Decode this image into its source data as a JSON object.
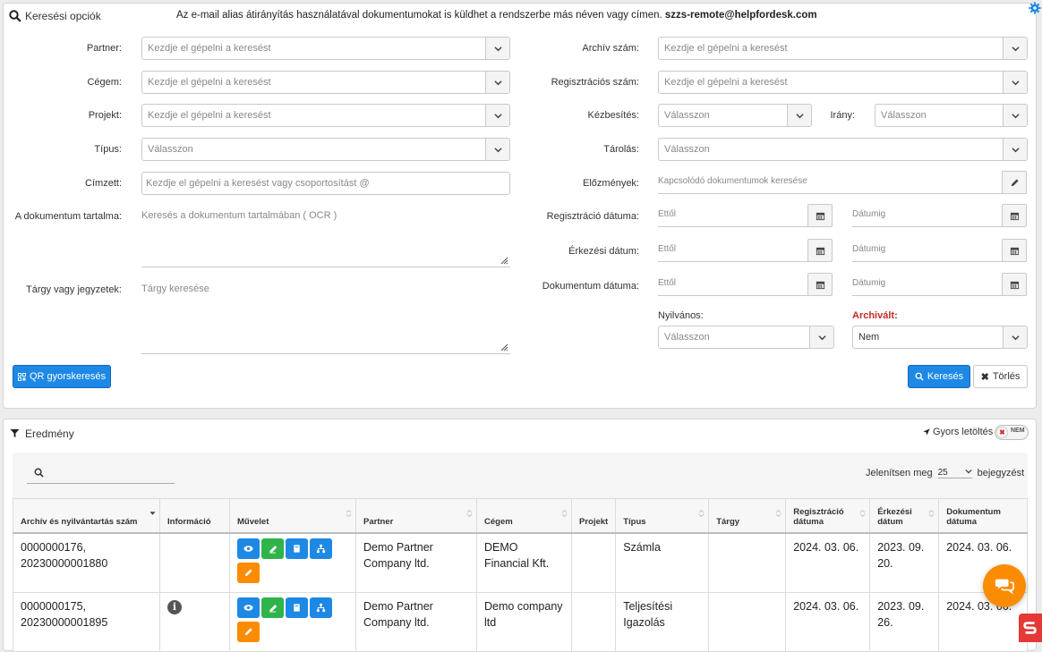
{
  "search": {
    "title": "Keresési opciók",
    "notice": "Az e-mail alias átirányítás használatával dokumentumokat is küldhet a rendszerbe más néven vagy címen.",
    "notice_email": "szzs-remote@helpfordesk.com",
    "left": {
      "partner": {
        "label": "Partner:",
        "placeholder": "Kezdje el gépelni a keresést"
      },
      "cegem": {
        "label": "Cégem:",
        "placeholder": "Kezdje el gépelni a keresést"
      },
      "projekt": {
        "label": "Projekt:",
        "placeholder": "Kezdje el gépelni a keresést"
      },
      "tipus": {
        "label": "Típus:",
        "placeholder": "Válasszon"
      },
      "cimzett": {
        "label": "Címzett:",
        "placeholder": "Kezdje el gépelni a keresést vagy csoportosítást @"
      },
      "tartalom": {
        "label": "A dokumentum tartalma:",
        "placeholder": "Keresés a dokumentum tartalmában ( OCR )"
      },
      "targy": {
        "label": "Tárgy vagy jegyzetek:",
        "placeholder": "Tárgy keresése"
      }
    },
    "right": {
      "archiv": {
        "label": "Archív szám:",
        "placeholder": "Kezdje el gépelni a keresést"
      },
      "regszam": {
        "label": "Regisztrációs szám:",
        "placeholder": "Kezdje el gépelni a keresést"
      },
      "kezbesites": {
        "label": "Kézbesítés:",
        "placeholder": "Válasszon"
      },
      "irany": {
        "label": "Irány:",
        "placeholder": "Válasszon"
      },
      "tarolas": {
        "label": "Tárolás:",
        "placeholder": "Válasszon"
      },
      "elozmenyek": {
        "label": "Előzmények:",
        "placeholder": "Kapcsolódó dokumentumok keresése"
      },
      "reg_datum": {
        "label": "Regisztráció dátuma:",
        "from": "Ettől",
        "to": "Dátumig"
      },
      "erk_datum": {
        "label": "Érkezési dátum:",
        "from": "Ettől",
        "to": "Dátumig"
      },
      "dok_datum": {
        "label": "Dokumentum dátuma:",
        "from": "Ettől",
        "to": "Dátumig"
      },
      "nyilvanos": {
        "label": "Nyilvános:",
        "placeholder": "Válasszon"
      },
      "archivalt": {
        "label": "Archivált:",
        "value": "Nem"
      }
    },
    "qr_button": "QR gyorskeresés",
    "search_button": "Keresés",
    "clear_button": "Törlés"
  },
  "results": {
    "title": "Eredmény",
    "quick_download": "Gyors letöltés",
    "toggle_state": "NEM",
    "show_label": "Jelenítsen meg",
    "page_size": "25",
    "entries_label": "bejegyzést",
    "columns": [
      "Archív és nyilvántartás szám",
      "Információ",
      "Művelet",
      "Partner",
      "Cégem",
      "Projekt",
      "Típus",
      "Tárgy",
      "Regisztráció dátuma",
      "Érkezési dátum",
      "Dokumentum dátuma"
    ],
    "rows": [
      {
        "archiv": "0000000176, 20230000001880",
        "partner": "Demo Partner Company ltd.",
        "cegem": "DEMO Financial Kft.",
        "projekt": "",
        "tipus": "Számla",
        "targy": "",
        "reg": "2024. 03. 06.",
        "erk": "2023. 09. 20.",
        "dok": "2024. 03. 06."
      },
      {
        "archiv": "0000000175, 20230000001895",
        "partner": "Demo Partner Company ltd.",
        "cegem": "Demo company ltd",
        "projekt": "",
        "tipus": "Teljesítési Igazolás",
        "targy": "",
        "reg": "2024. 03. 06.",
        "erk": "2023. 09. 26.",
        "dok": "2024. 03. 06."
      }
    ]
  },
  "colors": {
    "accent": "#1e88e5",
    "success": "#2eb44a",
    "warning": "#fb8c00",
    "required": "#c62828",
    "chat": "#fb8c00"
  }
}
